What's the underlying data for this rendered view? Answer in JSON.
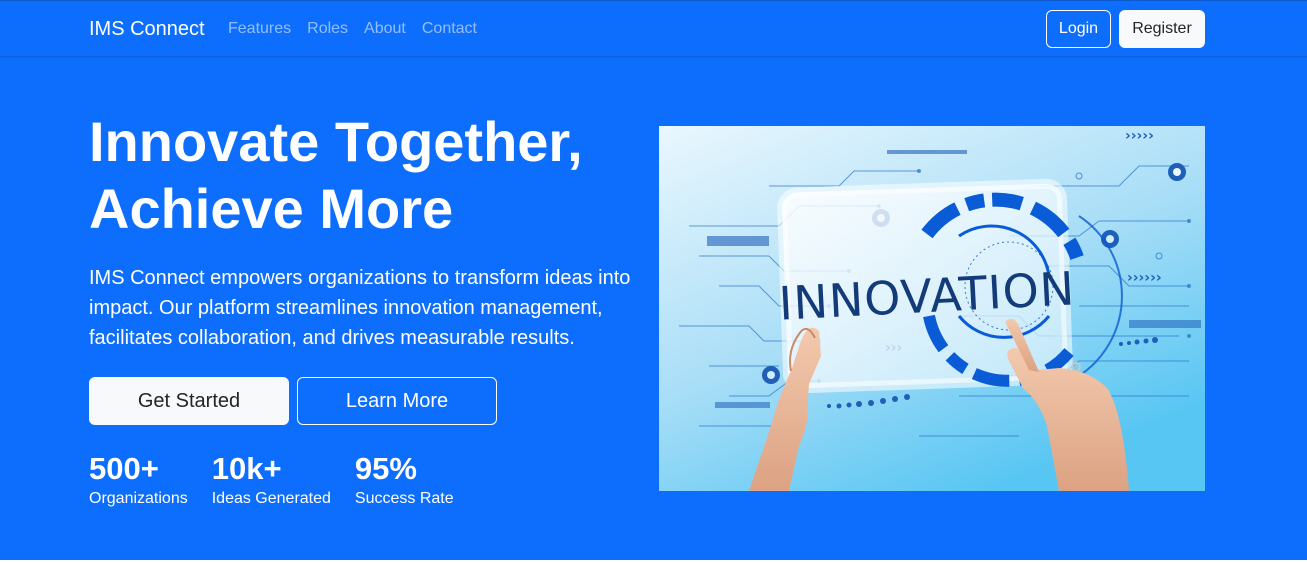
{
  "navbar": {
    "brand": "IMS Connect",
    "links": [
      "Features",
      "Roles",
      "About",
      "Contact"
    ],
    "login_label": "Login",
    "register_label": "Register"
  },
  "hero": {
    "title_line1": "Innovate Together,",
    "title_line2": "Achieve More",
    "lead": "IMS Connect empowers organizations to transform ideas into impact. Our platform streamlines innovation management, facilitates collaboration, and drives measurable results.",
    "primary_button": "Get Started",
    "secondary_button": "Learn More",
    "stats": [
      {
        "value": "500+",
        "label": "Organizations"
      },
      {
        "value": "10k+",
        "label": "Ideas Generated"
      },
      {
        "value": "95%",
        "label": "Success Rate"
      }
    ],
    "image_text": "INNOVATION"
  },
  "colors": {
    "primary": "#0d6efd",
    "light": "#f8f9fa",
    "dark_text": "#212529",
    "image_accent": "#0a5bd6"
  }
}
